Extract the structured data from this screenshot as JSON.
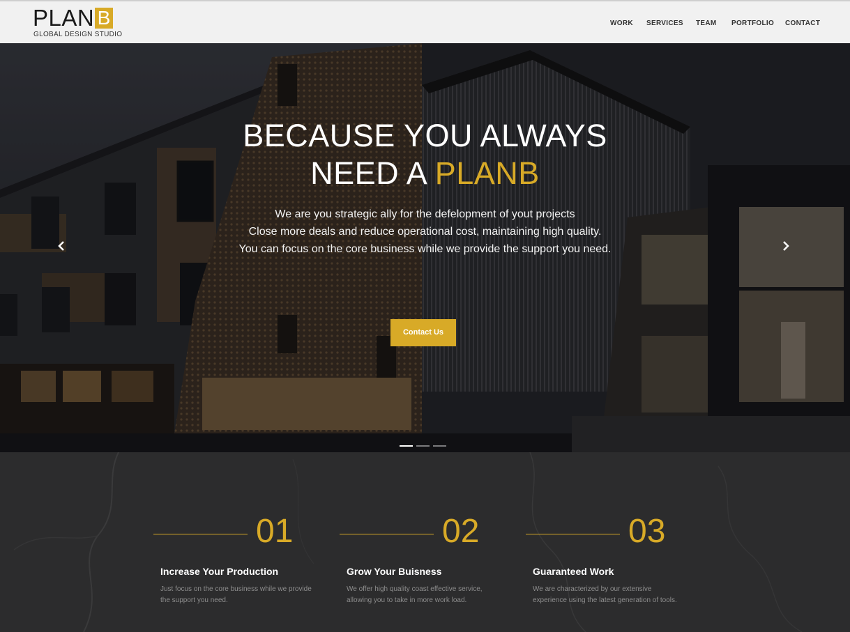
{
  "brand": {
    "word": "PLAN",
    "letter": "B",
    "tagline": "GLOBAL DESIGN STUDIO",
    "accent_color": "#d8aa27"
  },
  "nav": {
    "items": [
      {
        "label": "WORK"
      },
      {
        "label": "SERVICES"
      },
      {
        "label": "TEAM"
      },
      {
        "label": "PORTFOLIO"
      },
      {
        "label": "CONTACT"
      }
    ]
  },
  "hero": {
    "title_line1": "BECAUSE YOU ALWAYS",
    "title_line2_plain": "NEED A",
    "title_line2_accent": "PLANB",
    "lines": [
      "We are you strategic ally for the defelopment of yout projects",
      "Close more deals and reduce operational cost, maintaining high quality.",
      "You can focus on the core business while we provide the support you need."
    ],
    "cta_label": "Contact Us",
    "prev_icon": "chevron-left-icon",
    "next_icon": "chevron-right-icon",
    "slides": 3,
    "active_slide": 1
  },
  "features": [
    {
      "number": "01",
      "title": "Increase Your Production",
      "text": "Just focus on the core business while we provide the support you need."
    },
    {
      "number": "02",
      "title": "Grow Your Buisness",
      "text": "We offer high quality coast effective service, allowing you to take in more work load."
    },
    {
      "number": "03",
      "title": "Guaranteed Work",
      "text": "We are characterized by our extensive experience using the latest generation of tools."
    }
  ]
}
